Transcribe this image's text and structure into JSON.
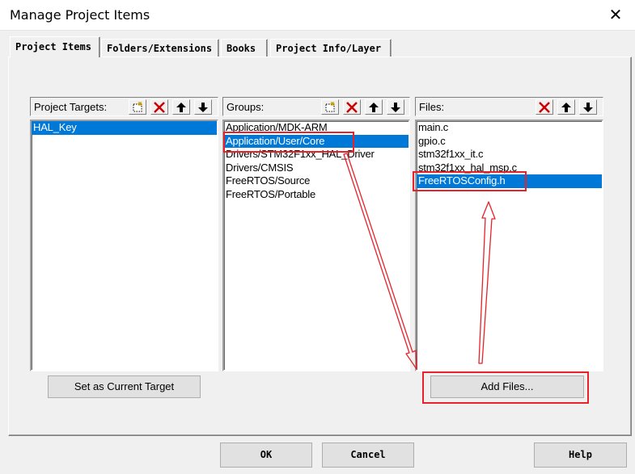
{
  "window": {
    "title": "Manage Project Items",
    "close_glyph": "✕"
  },
  "tabs": [
    {
      "label": "Project Items",
      "active": true
    },
    {
      "label": "Folders/Extensions",
      "active": false
    },
    {
      "label": "Books",
      "active": false
    },
    {
      "label": "Project Info/Layer",
      "active": false
    }
  ],
  "targets": {
    "label": "Project Targets:",
    "items": [
      "HAL_Key"
    ],
    "selected_index": 0
  },
  "groups": {
    "label": "Groups:",
    "items": [
      "Application/MDK-ARM",
      "Application/User/Core",
      "Drivers/STM32F1xx_HAL_Driver",
      "Drivers/CMSIS",
      "FreeRTOS/Source",
      "FreeRTOS/Portable"
    ],
    "selected_index": 1
  },
  "files": {
    "label": "Files:",
    "items": [
      "main.c",
      "gpio.c",
      "stm32f1xx_it.c",
      "stm32f1xx_hal_msp.c",
      "FreeRTOSConfig.h"
    ],
    "selected_index": 4
  },
  "buttons": {
    "set_target": "Set as Current Target",
    "add_files": "Add Files...",
    "ok": "OK",
    "cancel": "Cancel",
    "help": "Help"
  },
  "colors": {
    "selection": "#0078d7",
    "annotation": "#e8212a",
    "delete_icon": "#cc0000"
  },
  "icons": [
    "new-item-icon",
    "delete-icon",
    "move-up-icon",
    "move-down-icon"
  ]
}
